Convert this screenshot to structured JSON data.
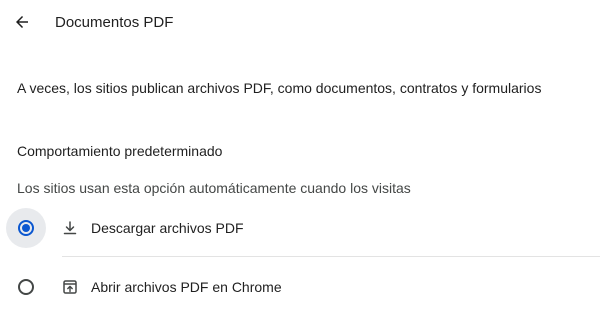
{
  "header": {
    "title": "Documentos PDF",
    "back_icon": "arrow-back-icon"
  },
  "description": "A veces, los sitios publican archivos PDF, como documentos, contratos y formularios",
  "default_behavior": {
    "heading": "Comportamiento predeterminado",
    "subtitle": "Los sitios usan esta opción automáticamente cuando los visitas",
    "options": [
      {
        "label": "Descargar archivos PDF",
        "icon": "download-icon",
        "selected": true
      },
      {
        "label": "Abrir archivos PDF en Chrome",
        "icon": "open-in-browser-icon",
        "selected": false
      }
    ]
  },
  "colors": {
    "accent": "#0b57d0",
    "text": "#1f1f1f",
    "secondary_text": "#444746",
    "divider": "#e3e3e3"
  }
}
